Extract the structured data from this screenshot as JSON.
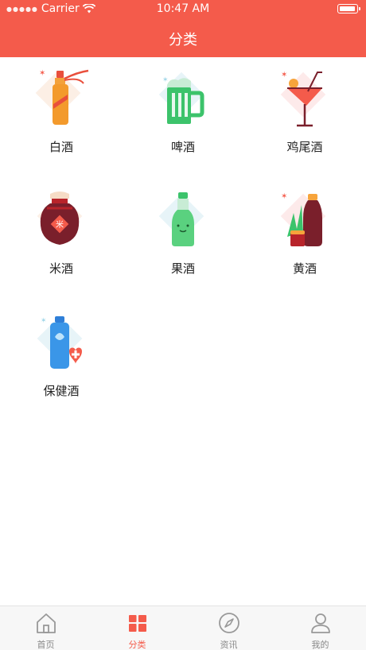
{
  "status_bar": {
    "carrier": "Carrier",
    "time": "10:47 AM"
  },
  "header": {
    "title": "分类"
  },
  "categories": [
    {
      "label": "白酒",
      "icon": "liquor-bottle-icon"
    },
    {
      "label": "啤酒",
      "icon": "beer-mug-icon"
    },
    {
      "label": "鸡尾酒",
      "icon": "cocktail-glass-icon"
    },
    {
      "label": "米酒",
      "icon": "rice-wine-jar-icon"
    },
    {
      "label": "果酒",
      "icon": "fruit-wine-bottle-icon"
    },
    {
      "label": "黄酒",
      "icon": "yellow-wine-icon"
    },
    {
      "label": "保健酒",
      "icon": "health-wine-bottle-icon"
    }
  ],
  "tabbar": {
    "items": [
      {
        "label": "首页",
        "icon": "home-icon",
        "active": false
      },
      {
        "label": "分类",
        "icon": "category-grid-icon",
        "active": true
      },
      {
        "label": "资讯",
        "icon": "compass-icon",
        "active": false
      },
      {
        "label": "我的",
        "icon": "user-icon",
        "active": false
      }
    ]
  },
  "colors": {
    "accent": "#f45b4b",
    "inactive": "#888888"
  }
}
